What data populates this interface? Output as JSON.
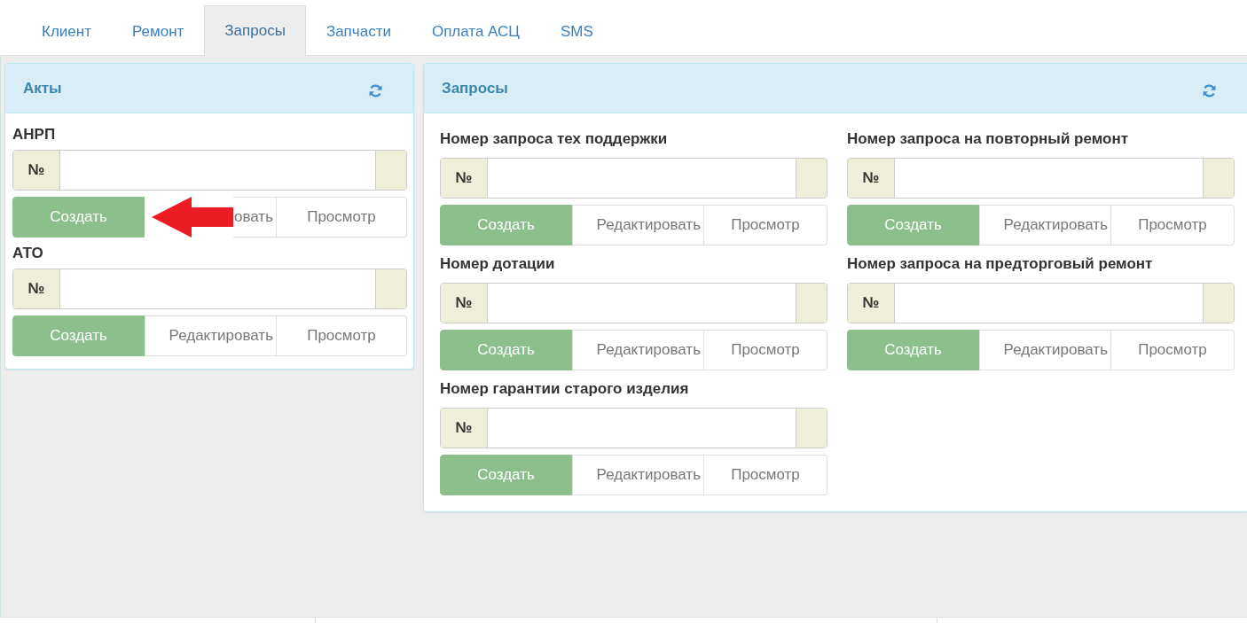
{
  "tabs": [
    {
      "label": "Клиент",
      "selected": false
    },
    {
      "label": "Ремонт",
      "selected": false
    },
    {
      "label": "Запросы",
      "selected": true
    },
    {
      "label": "Запчасти",
      "selected": false
    },
    {
      "label": "Оплата АСЦ",
      "selected": false
    },
    {
      "label": "SMS",
      "selected": false
    }
  ],
  "acts_panel": {
    "title": "Акты",
    "groups": [
      {
        "label": "АНРП",
        "prefix": "№",
        "buttons": [
          "Создать",
          "овать",
          "Просмотр"
        ],
        "arrow": true
      },
      {
        "label": "АТО",
        "prefix": "№",
        "buttons": [
          "Создать",
          "Редактировать",
          "Просмотр"
        ],
        "arrow": false
      }
    ]
  },
  "requests_panel": {
    "title": "Запросы",
    "groups": [
      {
        "label": "Номер запроса тех поддержки",
        "prefix": "№",
        "buttons": [
          "Создать",
          "Редактировать",
          "Просмотр"
        ]
      },
      {
        "label": "Номер запроса на повторный ремонт",
        "prefix": "№",
        "buttons": [
          "Создать",
          "Редактировать",
          "Просмотр"
        ]
      },
      {
        "label": "Номер дотации",
        "prefix": "№",
        "buttons": [
          "Создать",
          "Редактировать",
          "Просмотр"
        ]
      },
      {
        "label": "Номер запроса на предторговый ремонт",
        "prefix": "№",
        "buttons": [
          "Создать",
          "Редактировать",
          "Просмотр"
        ]
      },
      {
        "label": "Номер гарантии старого изделия",
        "prefix": "№",
        "buttons": [
          "Создать",
          "Редактировать",
          "Просмотр"
        ]
      }
    ]
  }
}
